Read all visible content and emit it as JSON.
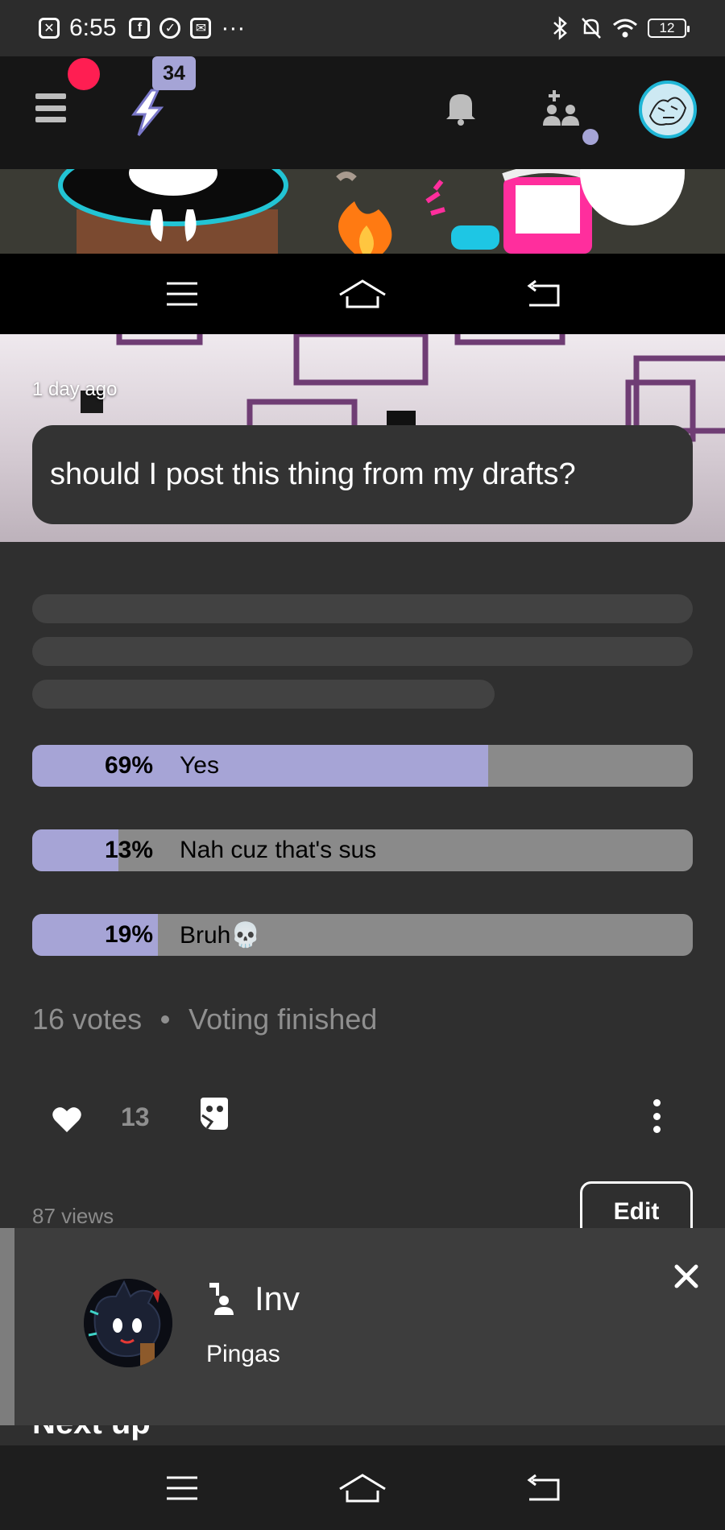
{
  "status_bar": {
    "time": "6:55",
    "more": "···",
    "battery": "12"
  },
  "header": {
    "notification_count": "34"
  },
  "post": {
    "time_ago": "1 day ago",
    "question": "should I post this thing from my drafts?"
  },
  "poll": {
    "options": [
      {
        "percent_label": "69%",
        "label": "Yes",
        "fraction": 0.69
      },
      {
        "percent_label": "13%",
        "label": "Nah cuz that's sus",
        "fraction": 0.13
      },
      {
        "percent_label": "19%",
        "label": "Bruh💀",
        "fraction": 0.19
      }
    ],
    "votes": "16 votes",
    "status": "Voting finished"
  },
  "actions": {
    "likes": "13"
  },
  "footer": {
    "views": "87 views",
    "edit_label": "Edit",
    "next_up": "Next up"
  },
  "notification": {
    "title": "Inv",
    "subtitle": "Pingas"
  },
  "colors": {
    "accent": "#a6a4d6",
    "alert": "#ff1e52",
    "background": "#2f2f2f",
    "poll_track": "#8a8a8a"
  },
  "icons": [
    "menu-icon",
    "bolt-icon",
    "bell-icon",
    "add-friend-icon",
    "heart-icon",
    "comment-icon",
    "more-vertical-icon",
    "close-icon",
    "nav-menu-icon",
    "nav-home-icon",
    "nav-back-icon"
  ]
}
